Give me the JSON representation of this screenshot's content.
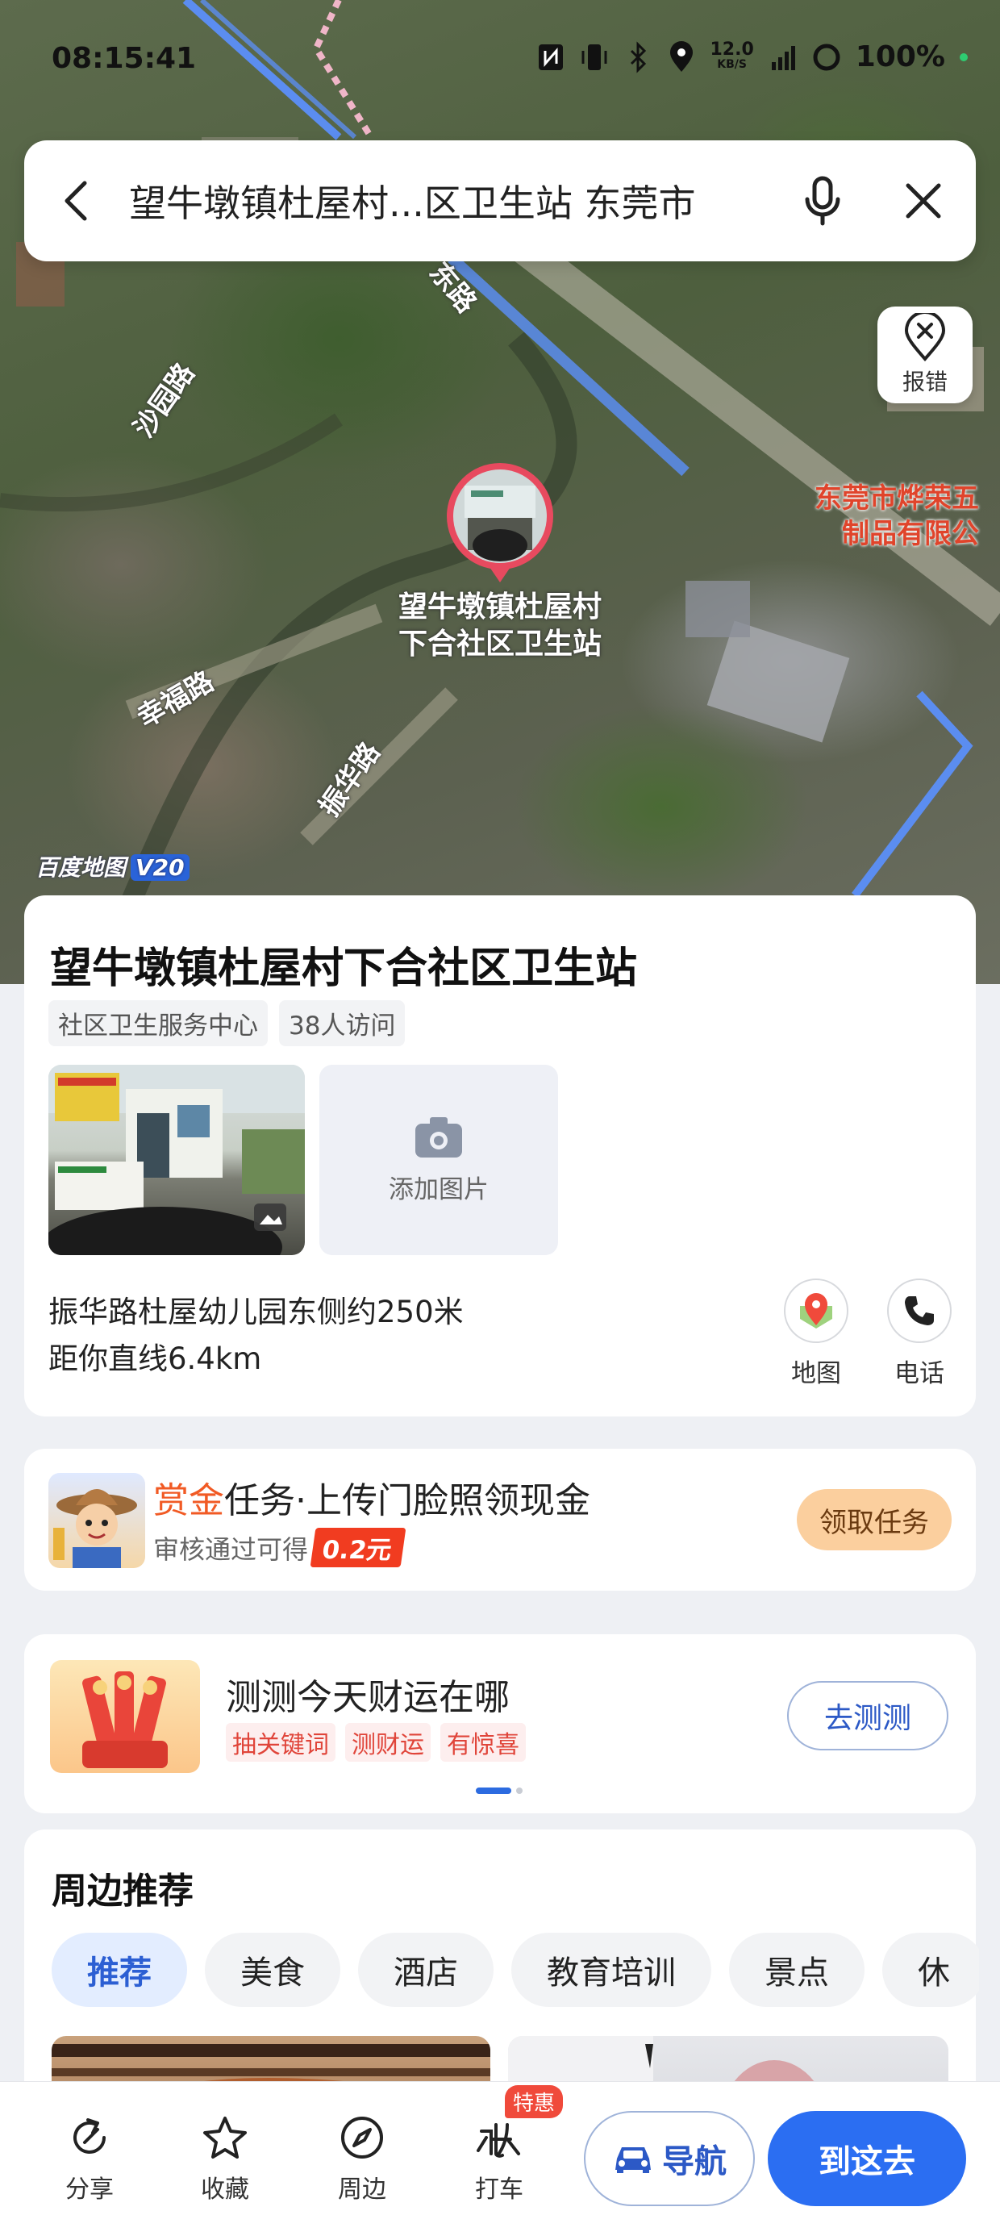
{
  "status_bar": {
    "time": "08:15:41",
    "net_speed_value": "12.0",
    "net_speed_unit": "KB/S",
    "battery": "100%"
  },
  "search": {
    "query": "望牛墩镇杜屋村...区卫生站 东莞市"
  },
  "map": {
    "report_label": "报错",
    "road_labels": [
      "沙园路",
      "幸福路",
      "振华路",
      "东路"
    ],
    "company_label_line1": "东莞市烨荣五",
    "company_label_line2": "制品有限公",
    "poi_name_line1": "望牛墩镇杜屋村",
    "poi_name_line2": "下合社区卫生站",
    "logo_text": "百度地图",
    "logo_version": "V20"
  },
  "poi": {
    "title": "望牛墩镇杜屋村下合社区卫生站",
    "tags": [
      "社区卫生服务中心",
      "38人访问"
    ],
    "add_photo_label": "添加图片",
    "address": "振华路杜屋幼儿园东侧约250米",
    "distance": "距你直线6.4km",
    "actions": {
      "map_label": "地图",
      "phone_label": "电话"
    }
  },
  "task": {
    "title_highlight": "赏金",
    "title_rest": "任务·上传门脸照领现金",
    "subtitle": "审核通过可得",
    "reward": "0.2元",
    "button": "领取任务"
  },
  "fortune": {
    "title": "测测今天财运在哪",
    "tags": [
      "抽关键词",
      "测财运",
      "有惊喜"
    ],
    "button": "去测测"
  },
  "nearby": {
    "title": "周边推荐",
    "tabs": [
      "推荐",
      "美食",
      "酒店",
      "教育培训",
      "景点",
      "休"
    ]
  },
  "bottom_bar": {
    "share": "分享",
    "favorite": "收藏",
    "around": "周边",
    "taxi": "打车",
    "taxi_badge": "特惠",
    "navigate": "导航",
    "go_here": "到这去"
  },
  "colors": {
    "accent": "#2b6ef2",
    "highlight": "#f15a24",
    "map_pin": "#e84a5f"
  }
}
